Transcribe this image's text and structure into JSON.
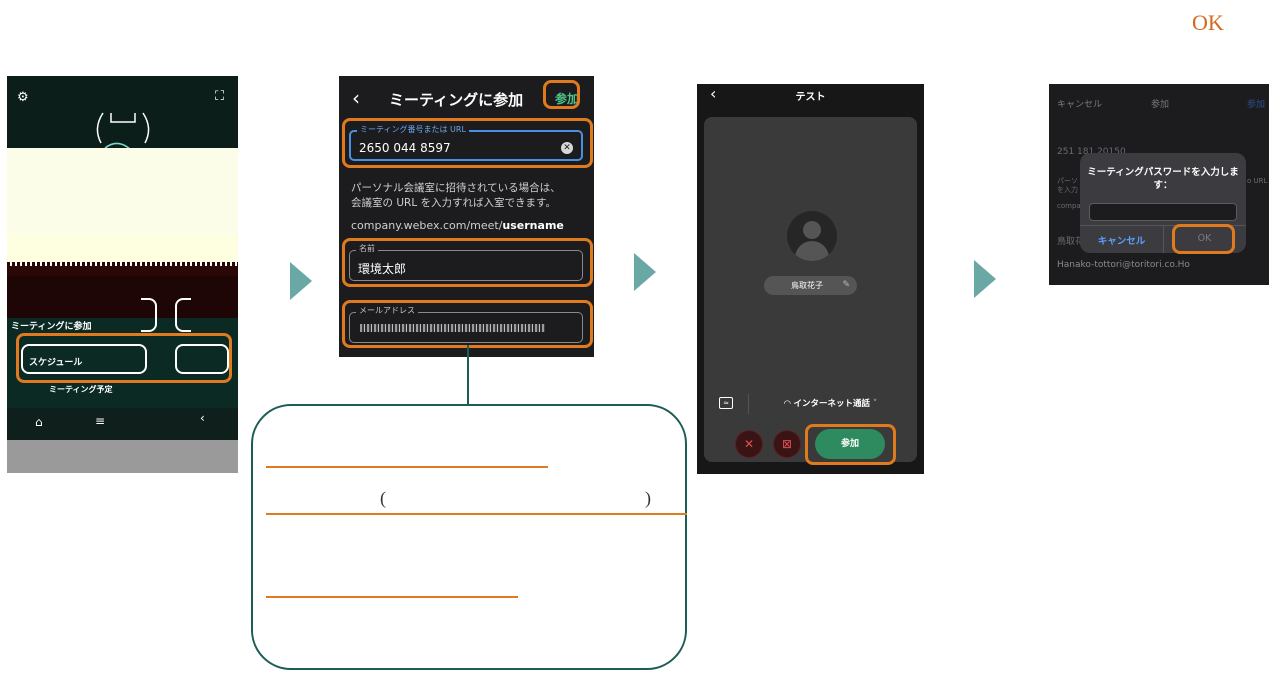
{
  "top_label": "OK",
  "screen1": {
    "btn1_label": "ミーティングに参加",
    "btn2_label": "スケジュール",
    "time_label": "ミーティング予定"
  },
  "screen2": {
    "title": "ミーティングに参加",
    "join_button": "参加",
    "meeting_field": {
      "label": "ミーティング番号または URL",
      "value": "2650 044 8597"
    },
    "help_text_1": "パーソナル会議室に招待されている場合は、",
    "help_text_2": "会議室の URL を入力すれば入室できます。",
    "url_prefix": "company.webex.com/meet/",
    "url_bold": "username",
    "name_field": {
      "label": "名前",
      "value": "環境太郎"
    },
    "email_field": {
      "label": "メールアドレス"
    }
  },
  "callout": {
    "paren_open": "(",
    "paren_close": ")"
  },
  "screen3": {
    "title": "テスト",
    "display_name": "鳥取花子",
    "audio_mode": "インターネット通話",
    "join_button": "参加"
  },
  "screen4": {
    "cancel_top": "キャンセル",
    "title": "参加",
    "join_top": "参加",
    "meeting_number": "251 181 20150",
    "help_line_1": "パーソ",
    "help_line_2": "を入力",
    "url_suffix": "o URL",
    "company_prefix": "compa",
    "name_prefix": "鳥取花",
    "email": "Hanako-tottori@toritori.co.Ho",
    "dialog_title": "ミーティングパスワードを入力します：",
    "dialog_cancel": "キャンセル",
    "dialog_ok": "OK"
  },
  "colors": {
    "highlight": "#e07a1f",
    "arrow": "#6aa8a5",
    "callout_border": "#1e5d56",
    "join_green": "#2e8b5f"
  }
}
